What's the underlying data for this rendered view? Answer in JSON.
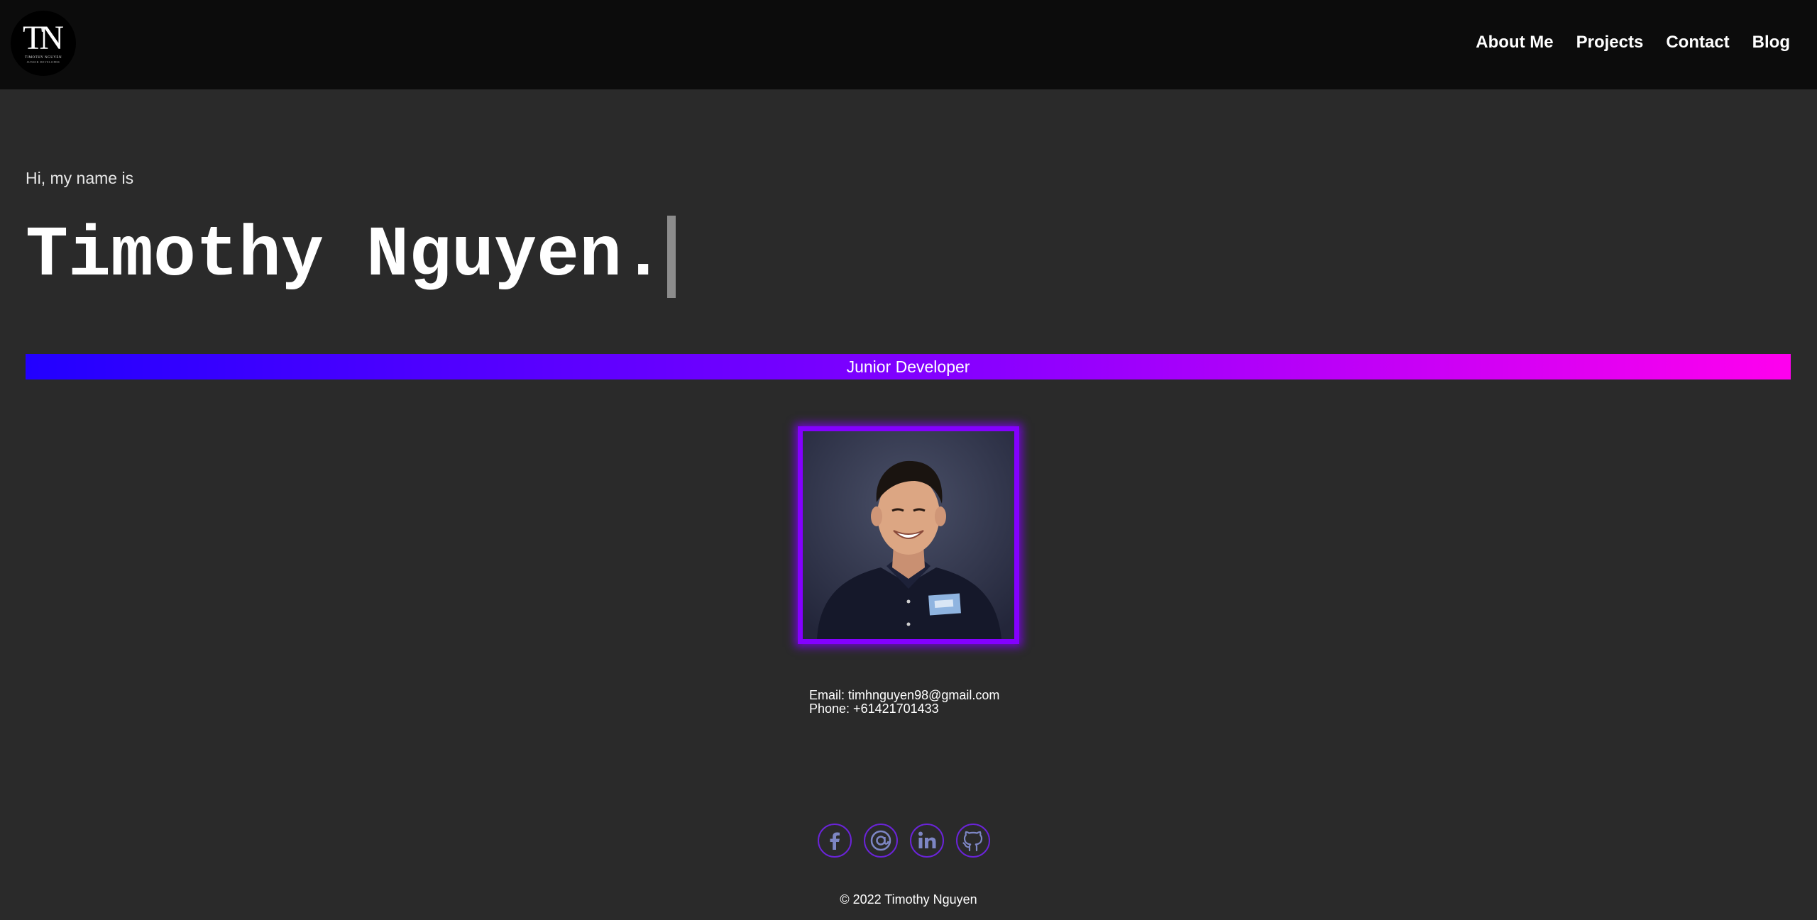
{
  "header": {
    "logo": {
      "monogram": "TN",
      "name": "TIMOTHY NGUYEN",
      "subtitle": "JUNIOR DEVELOPER",
      "icon": "tn-monogram-logo"
    },
    "nav": [
      "About Me",
      "Projects",
      "Contact",
      "Blog"
    ]
  },
  "hero": {
    "greeting": "Hi, my name is",
    "name": "Timothy Nguyen.",
    "role": "Junior Developer"
  },
  "portrait": {
    "description_icon": "profile-photo"
  },
  "contact": {
    "email_line": "Email: timhnguyen98@gmail.com",
    "phone_line": "Phone: +61421701433"
  },
  "socials": [
    {
      "icon": "facebook-icon"
    },
    {
      "icon": "email-at-icon"
    },
    {
      "icon": "linkedin-icon"
    },
    {
      "icon": "github-icon"
    }
  ],
  "footer": {
    "copyright": "© 2022 Timothy Nguyen"
  },
  "colors": {
    "page_bg": "#2a2a2a",
    "header_bg": "#0c0c0c",
    "gradient_start": "#2200ff",
    "gradient_end": "#ff00ee",
    "accent_purple": "#8400ff",
    "social_icon": "#7d86c4"
  }
}
